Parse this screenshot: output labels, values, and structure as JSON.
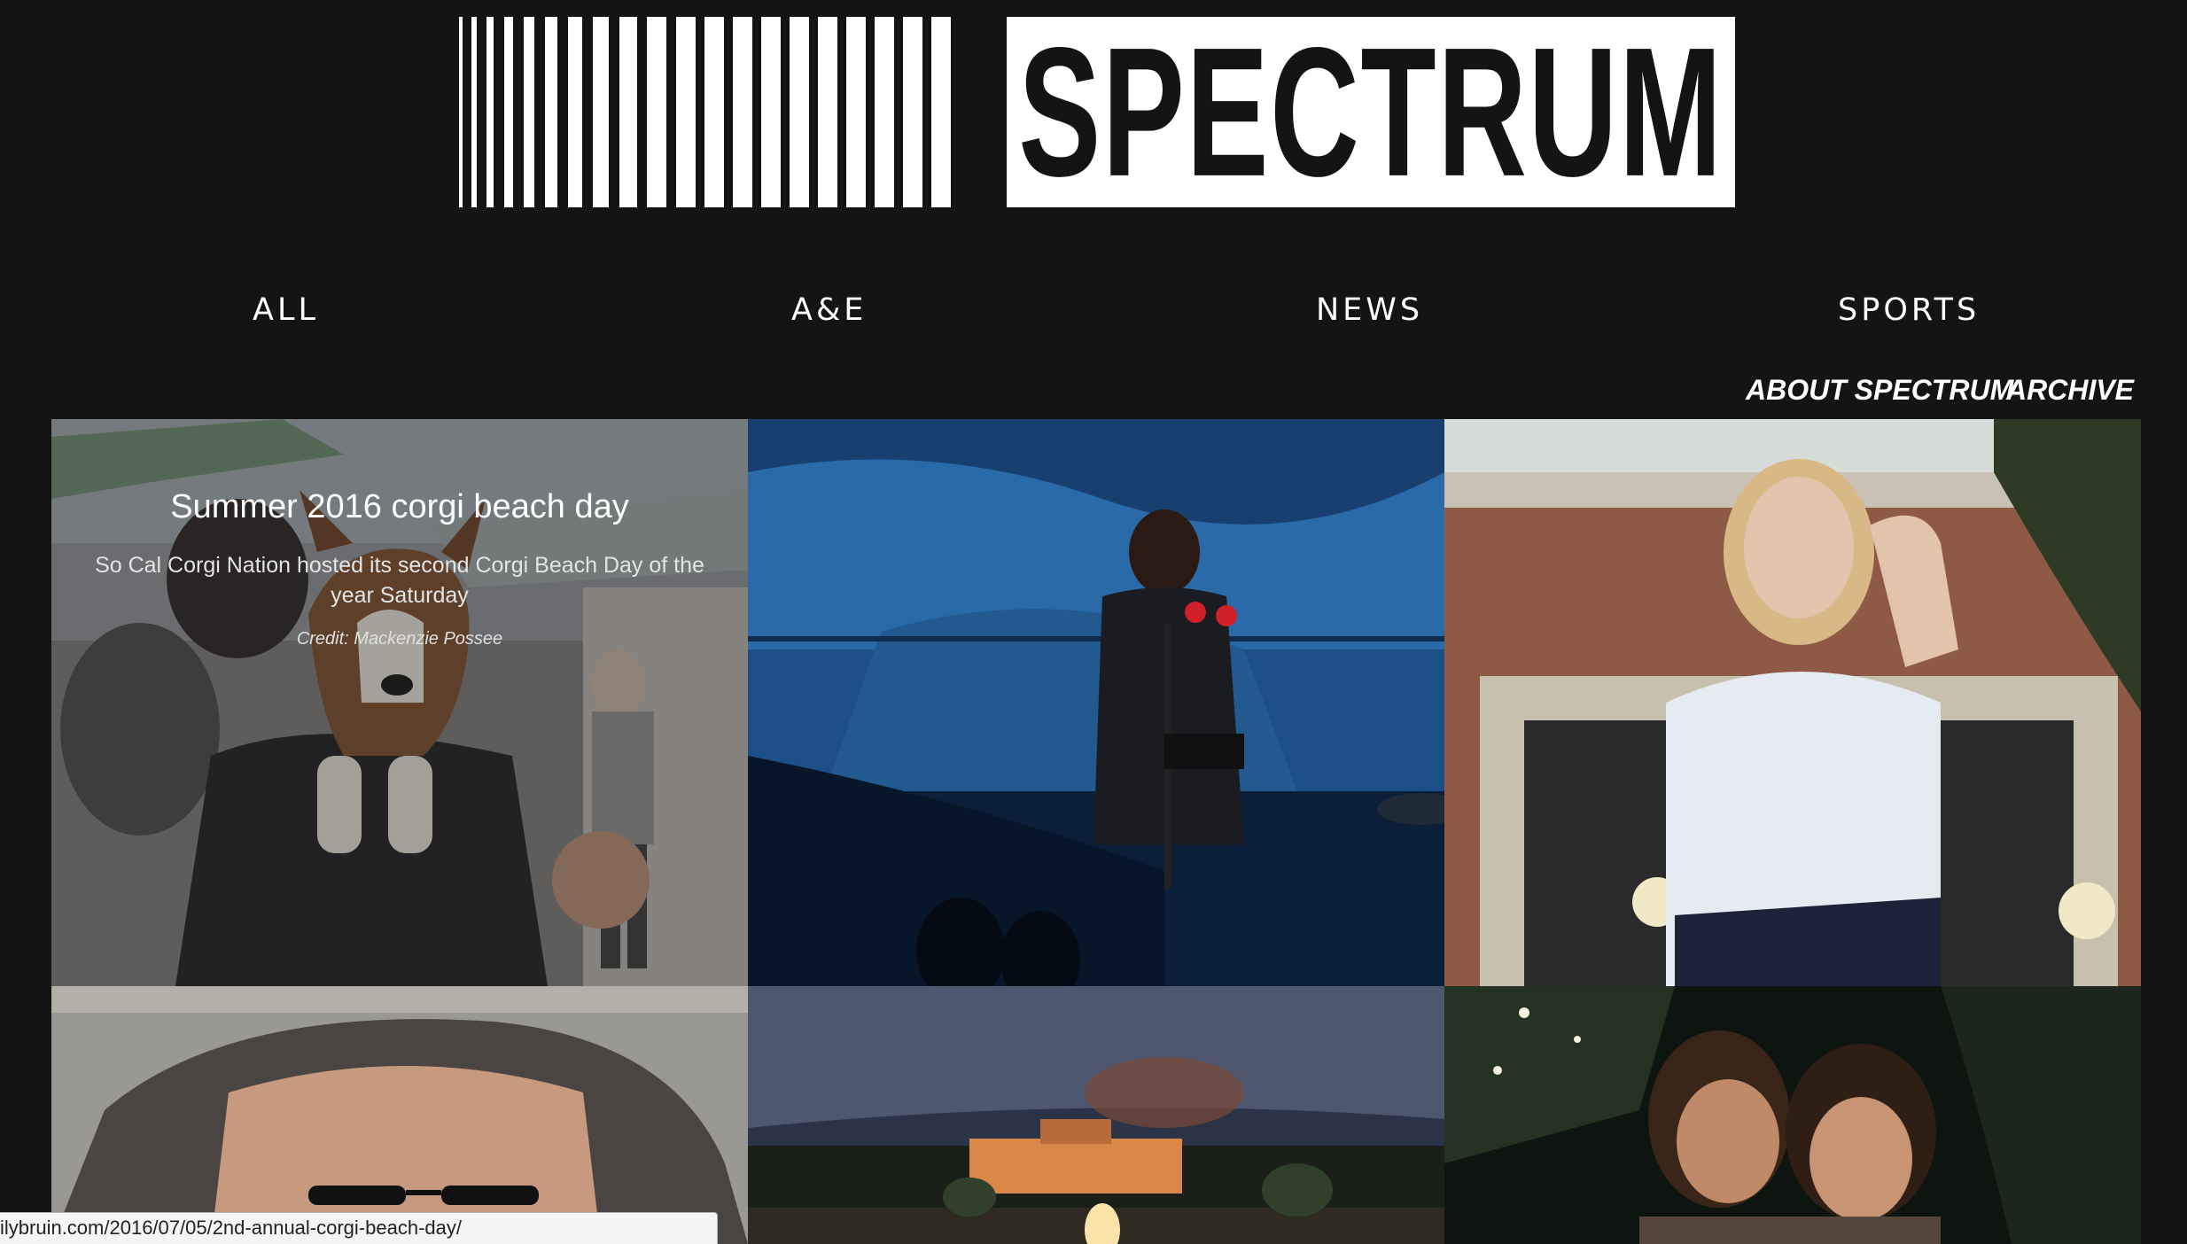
{
  "logo": {
    "wordmark": "SPECTRUM"
  },
  "nav": {
    "items": [
      {
        "label": "ALL"
      },
      {
        "label": "A&E"
      },
      {
        "label": "NEWS"
      },
      {
        "label": "SPORTS"
      }
    ],
    "secondary": [
      {
        "label": "ABOUT SPECTRUM"
      },
      {
        "label": "ARCHIVE"
      }
    ]
  },
  "featured": {
    "title": "Summer 2016 corgi beach day",
    "description": "So Cal Corgi Nation hosted its second Corgi Beach Day of the year Saturday",
    "credit": "Credit: Mackenzie Possee"
  },
  "tiles": [
    {
      "subject": "corgi beach day photo"
    },
    {
      "subject": "performer on stage photo"
    },
    {
      "subject": "woman portrait photo"
    },
    {
      "subject": "man with glasses close-up photo"
    },
    {
      "subject": "campus night event photo"
    },
    {
      "subject": "candlelight vigil photo"
    }
  ],
  "statusbar": {
    "url": "ilybruin.com/2016/07/05/2nd-annual-corgi-beach-day/"
  },
  "colors": {
    "background": "#141414",
    "text": "#ffffff"
  }
}
